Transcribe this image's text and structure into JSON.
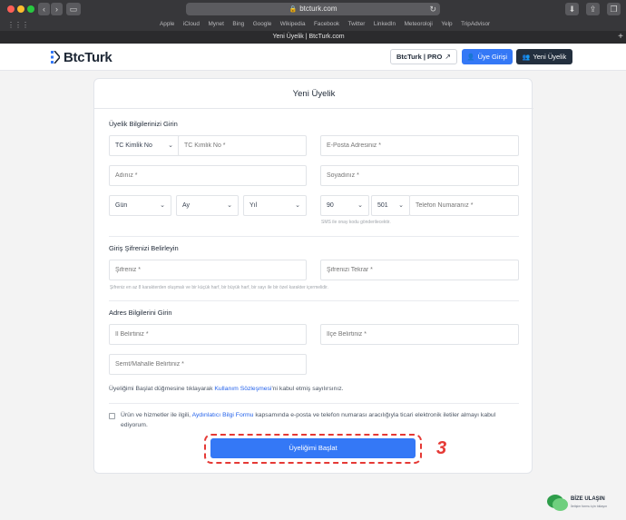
{
  "browser": {
    "url": "btcturk.com",
    "tab_title": "Yeni Üyelik | BtcTurk.com",
    "favorites": [
      "Apple",
      "iCloud",
      "Mynet",
      "Bing",
      "Google",
      "Wikipedia",
      "Facebook",
      "Twitter",
      "LinkedIn",
      "Meteoroloji",
      "Yelp",
      "TripAdvisor"
    ]
  },
  "header": {
    "logo_text": "BtcTurk",
    "pro_label": "BtcTurk | PRO",
    "login_label": "Üye Girişi",
    "signup_label": "Yeni Üyelik",
    "accent_color": "#3478f6",
    "dark_color": "#232f3e"
  },
  "form": {
    "title": "Yeni Üyelik",
    "section_personal": "Üyelik Bilgilerinizi Girin",
    "id_type": "TC Kimlik No",
    "id_placeholder": "TC Kimlik No *",
    "email_placeholder": "E-Posta Adresiniz *",
    "firstname_placeholder": "Adınız *",
    "lastname_placeholder": "Soyadınız *",
    "day": "Gün",
    "month": "Ay",
    "year": "Yıl",
    "country_code": "90",
    "operator_code": "501",
    "phone_placeholder": "Telefon Numaranız *",
    "sms_hint": "SMS ile onay kodu gönderilecektir.",
    "section_password": "Giriş Şifrenizi Belirleyin",
    "password_placeholder": "Şifreniz *",
    "password_repeat_placeholder": "Şifrenizi Tekrar *",
    "password_hint": "Şifreniz en az 8 karakterden oluşmalı ve bir küçük harf, bir büyük harf, bir sayı ile bir özel karakter içermelidir.",
    "section_address": "Adres Bilgilerini Girin",
    "city_placeholder": "İl Belirtiniz *",
    "district_placeholder": "İlçe Belirtiniz *",
    "neighborhood_placeholder": "Semt/Mahalle Belirtiniz *",
    "terms_prefix": "Üyeliğimi Başlat düğmesine tıklayarak ",
    "terms_link": "Kullanım Sözleşmesi",
    "terms_suffix": "'ni kabul etmiş sayılırsınız.",
    "consent_prefix": "Ürün ve hizmetler ile ilgili, ",
    "consent_link": "Aydınlatıcı Bilgi Formu",
    "consent_suffix": " kapsamında e-posta ve telefon numarası aracılığıyla ticari elektronik iletiler almayı kabul ediyorum.",
    "consent_checked": false,
    "submit_label": "Üyeliğimi Başlat",
    "step_number": "3",
    "highlight_color": "#e53935"
  },
  "contact": {
    "title": "BİZE ULAŞIN",
    "subtitle": "İletişim formu için tıklayın"
  }
}
